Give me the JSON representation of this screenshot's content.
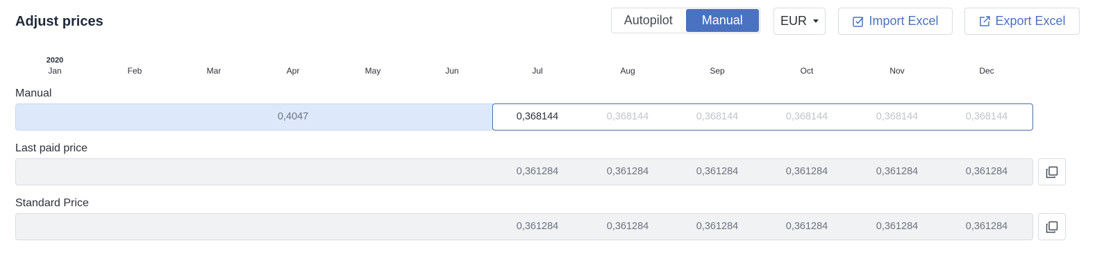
{
  "header": {
    "title": "Adjust prices",
    "mode_toggle": {
      "autopilot_label": "Autopilot",
      "manual_label": "Manual",
      "active": "Manual"
    },
    "currency": {
      "selected": "EUR"
    },
    "import_label": "Import Excel",
    "export_label": "Export Excel",
    "accent_color": "#4a72c0"
  },
  "timeline": {
    "year": "2020",
    "months": [
      "Jan",
      "Feb",
      "Mar",
      "Apr",
      "May",
      "Jun",
      "Jul",
      "Aug",
      "Sep",
      "Oct",
      "Nov",
      "Dec"
    ]
  },
  "rows": {
    "manual": {
      "label": "Manual",
      "past_value": "0,4047",
      "future_values": [
        "0,368144",
        "0,368144",
        "0,368144",
        "0,368144",
        "0,368144",
        "0,368144"
      ]
    },
    "last_paid": {
      "label": "Last paid price",
      "values": [
        "0,361284",
        "0,361284",
        "0,361284",
        "0,361284",
        "0,361284",
        "0,361284"
      ]
    },
    "standard": {
      "label": "Standard Price",
      "values": [
        "0,361284",
        "0,361284",
        "0,361284",
        "0,361284",
        "0,361284",
        "0,361284"
      ]
    }
  },
  "icons": {
    "import": "import-edit-icon",
    "export": "external-link-icon",
    "copy": "copy-icon",
    "currency_caret": "chevron-down-icon"
  }
}
